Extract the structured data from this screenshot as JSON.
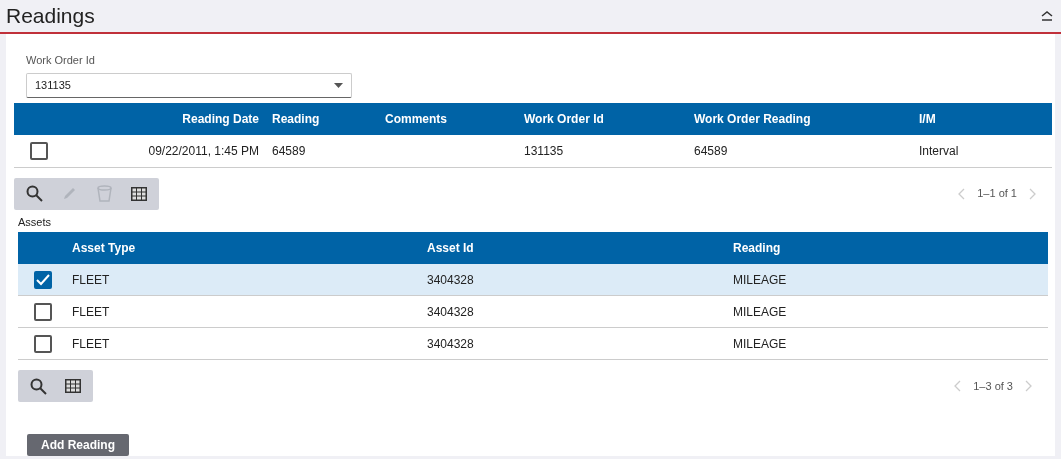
{
  "section": {
    "title": "Readings",
    "expanded": true
  },
  "work_order_field": {
    "label": "Work Order Id",
    "value": "131135"
  },
  "readings_table": {
    "columns": [
      "Reading Date",
      "Reading",
      "Comments",
      "Work Order Id",
      "Work Order Reading",
      "I/M"
    ],
    "rows": [
      {
        "selected": false,
        "cells": [
          "09/22/2011, 1:45 PM",
          "64589",
          "",
          "131135",
          "64589",
          "Interval"
        ]
      }
    ],
    "toolbar": [
      {
        "kind": "search",
        "disabled": false
      },
      {
        "kind": "edit",
        "disabled": true
      },
      {
        "kind": "delete",
        "disabled": true
      },
      {
        "kind": "grid",
        "disabled": false
      }
    ],
    "pagination": "1–1 of 1"
  },
  "assets_label": "Assets",
  "assets_table": {
    "columns": [
      "Asset Type",
      "Asset Id",
      "Reading"
    ],
    "rows": [
      {
        "selected": true,
        "cells": [
          "FLEET",
          "3404328",
          "MILEAGE"
        ]
      },
      {
        "selected": false,
        "cells": [
          "FLEET",
          "3404328",
          "MILEAGE"
        ]
      },
      {
        "selected": false,
        "cells": [
          "FLEET",
          "3404328",
          "MILEAGE"
        ]
      }
    ],
    "toolbar": [
      {
        "kind": "search",
        "disabled": false
      },
      {
        "kind": "grid",
        "disabled": false
      }
    ],
    "pagination": "1–3 of 3"
  },
  "buttons": [
    "Add Reading"
  ]
}
